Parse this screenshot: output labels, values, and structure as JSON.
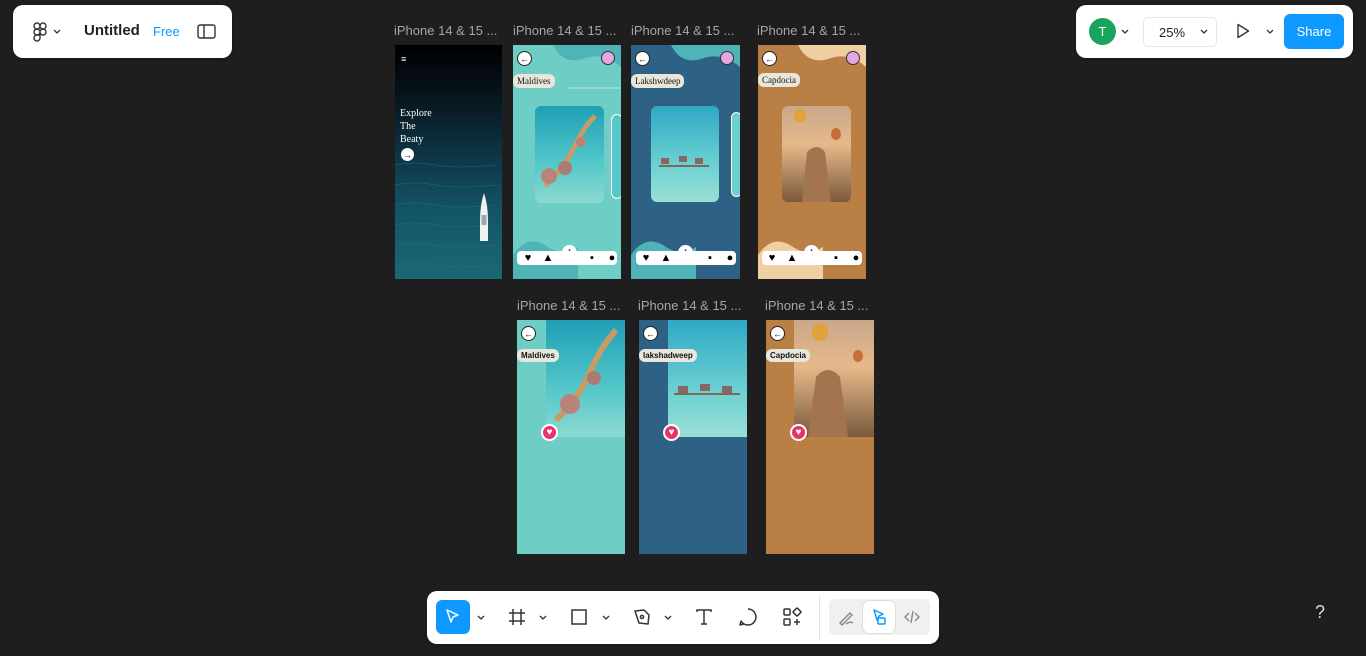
{
  "file": {
    "title": "Untitled",
    "plan_badge": "Free",
    "figma_menu_icon": "figma-logo-icon",
    "panel_toggle_icon": "sidebar-toggle-icon"
  },
  "header_right": {
    "avatar_initial": "T",
    "avatar_color": "#1aa35a",
    "zoom": "25%",
    "share_label": "Share",
    "accent": "#0d99ff"
  },
  "frames": [
    {
      "label": "iPhone 14 & 15 ...",
      "kind": "home",
      "hero_text": [
        "Explore",
        "The",
        "Beaty"
      ]
    },
    {
      "label": "iPhone 14 & 15 ...",
      "kind": "detail",
      "place": "Maldives",
      "bg": "#6ecdc5"
    },
    {
      "label": "iPhone 14 & 15 ...",
      "kind": "detail",
      "place": "Lakshwdeep",
      "bg": "#2d6285"
    },
    {
      "label": "iPhone 14 & 15 ...",
      "kind": "detail",
      "place": "Capdocia",
      "bg": "#b97f45"
    },
    {
      "label": "iPhone 14 & 15 ...",
      "kind": "like",
      "place": "Maldives",
      "bg": "#6ecdc5"
    },
    {
      "label": "iPhone 14 & 15 ...",
      "kind": "like",
      "place": "lakshadweep",
      "bg": "#2d6285"
    },
    {
      "label": "iPhone 14 & 15 ...",
      "kind": "like",
      "place": "Capdocia",
      "bg": "#b97f45"
    }
  ],
  "toolbar": {
    "tools": [
      "move-tool",
      "frame-tool",
      "rectangle-tool",
      "pen-tool",
      "text-tool",
      "comment-tool",
      "actions-tool"
    ],
    "modes": [
      "draw-mode",
      "design-mode",
      "dev-mode"
    ]
  },
  "help_label": "?"
}
